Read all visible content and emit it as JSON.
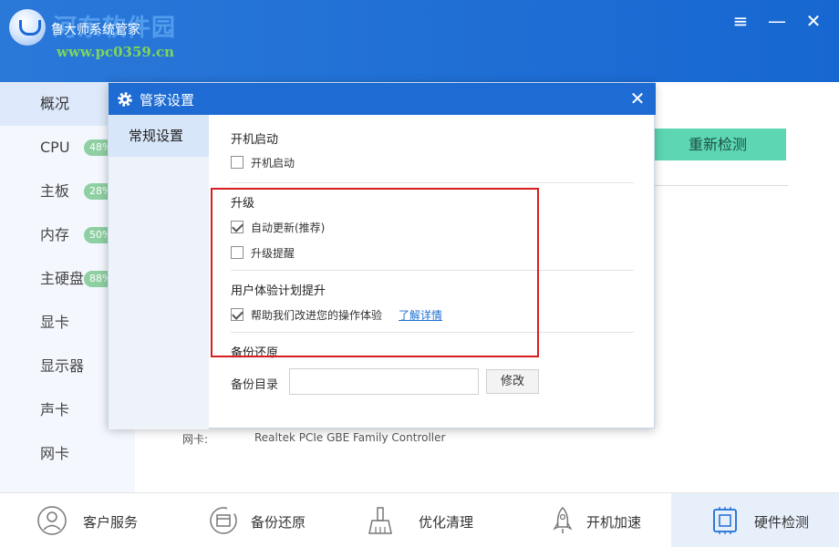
{
  "app": {
    "title": "鲁大师系统管家"
  },
  "watermark": {
    "line1": "河东软件园",
    "line2": "www.pc0359.cn"
  },
  "window_controls": {
    "menu": "≡",
    "minimize": "—",
    "close": "✕"
  },
  "sidebar": {
    "items": [
      {
        "label": "概况",
        "badge": ""
      },
      {
        "label": "CPU",
        "badge": "48%"
      },
      {
        "label": "主板",
        "badge": "28%"
      },
      {
        "label": "内存",
        "badge": "50%"
      },
      {
        "label": "主硬盘",
        "badge": "88%"
      },
      {
        "label": "显卡",
        "badge": ""
      },
      {
        "label": "显示器",
        "badge": ""
      },
      {
        "label": "声卡",
        "badge": ""
      },
      {
        "label": "网卡",
        "badge": ""
      }
    ]
  },
  "main": {
    "recheck_label": "重新检测",
    "network_label": "网卡:",
    "network_value": "Realtek PCIe GBE Family Controller"
  },
  "bottom_bar": {
    "items": [
      {
        "label": "客户服务",
        "icon": "headset-icon"
      },
      {
        "label": "备份还原",
        "icon": "backup-icon"
      },
      {
        "label": "优化清理",
        "icon": "broom-icon"
      },
      {
        "label": "开机加速",
        "icon": "rocket-icon"
      },
      {
        "label": "硬件检测",
        "icon": "chip-icon"
      }
    ]
  },
  "dialog": {
    "title": "管家设置",
    "close": "✕",
    "sidebar_item": "常规设置",
    "startup": {
      "title": "开机启动",
      "option_label": "开机启动",
      "checked": false
    },
    "upgrade": {
      "title": "升级",
      "auto_update_label": "自动更新(推荐)",
      "auto_update_checked": true,
      "reminder_label": "升级提醒",
      "reminder_checked": false
    },
    "experience": {
      "title": "用户体验计划提升",
      "option_label": "帮助我们改进您的操作体验",
      "checked": true,
      "link_label": "了解详情"
    },
    "backup": {
      "title": "备份还原",
      "dir_label": "备份目录",
      "dir_value": "",
      "modify_label": "修改"
    }
  },
  "colors": {
    "titlebar": "#1e6cd3",
    "accent_green": "#5cd6b3",
    "highlight_red": "#d81e1e",
    "link_blue": "#1f6fd0"
  }
}
